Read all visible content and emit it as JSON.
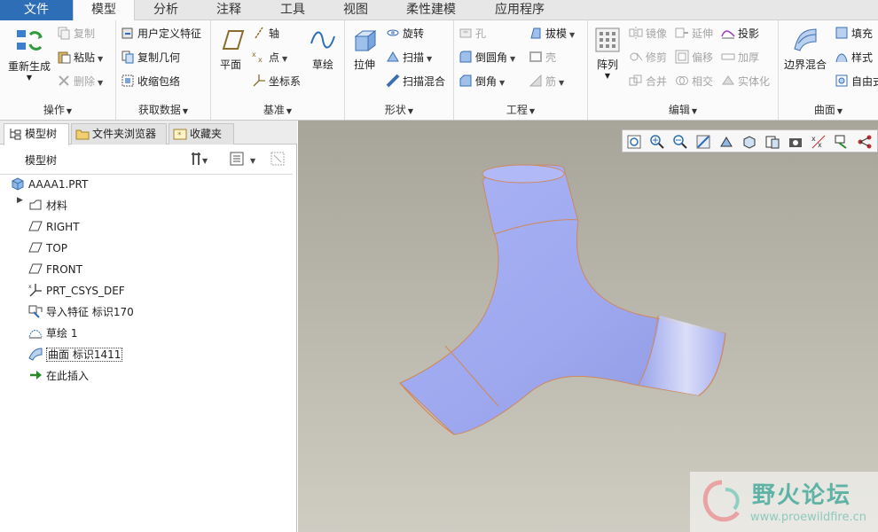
{
  "menu_tabs": [
    "文件",
    "模型",
    "分析",
    "注释",
    "工具",
    "视图",
    "柔性建模",
    "应用程序"
  ],
  "ribbon": {
    "groups": [
      "操作",
      "获取数据",
      "基准",
      "形状",
      "工程",
      "编辑",
      "曲面"
    ],
    "operation": {
      "regenerate": "重新生成",
      "copy": "复制",
      "paste": "粘贴",
      "delete": "删除"
    },
    "get_data": {
      "udf": "用户定义特征",
      "copy_geom": "复制几何",
      "shrinkwrap": "收缩包络"
    },
    "datum": {
      "plane": "平面",
      "axis": "轴",
      "point": "点",
      "csys": "坐标系",
      "sketch": "草绘"
    },
    "shape": {
      "extrude": "拉伸",
      "revolve": "旋转",
      "sweep": "扫描",
      "swept_blend": "扫描混合"
    },
    "engineering": {
      "hole": "孔",
      "round": "倒圆角",
      "chamfer": "倒角",
      "draft": "拔模",
      "shell": "壳",
      "rib": "筋"
    },
    "pattern": "阵列",
    "edit": {
      "mirror": "镜像",
      "trim": "修剪",
      "merge": "合并",
      "extend": "延伸",
      "offset": "偏移",
      "intersect": "相交",
      "project": "投影",
      "thicken": "加厚",
      "solidify": "实体化"
    },
    "surface": {
      "boundary_blend": "边界混合",
      "fill": "填充",
      "style": "样式",
      "freeform": "自由式"
    }
  },
  "panel_tabs": [
    "模型树",
    "文件夹浏览器",
    "收藏夹"
  ],
  "tree_title": "模型树",
  "tree_items": [
    "AAAA1.PRT",
    "材料",
    "RIGHT",
    "TOP",
    "FRONT",
    "PRT_CSYS_DEF",
    "导入特征 标识170",
    "草绘 1",
    "曲面 标识1411",
    "在此插入"
  ],
  "watermark": {
    "title": "野火论坛",
    "url": "www.proewildfire.cn"
  },
  "colors": {
    "file_tab": "#2d6eb6",
    "surface": "#9ea8ee",
    "edge": "#d0875a",
    "insert_arrow": "#2a8a2a"
  }
}
